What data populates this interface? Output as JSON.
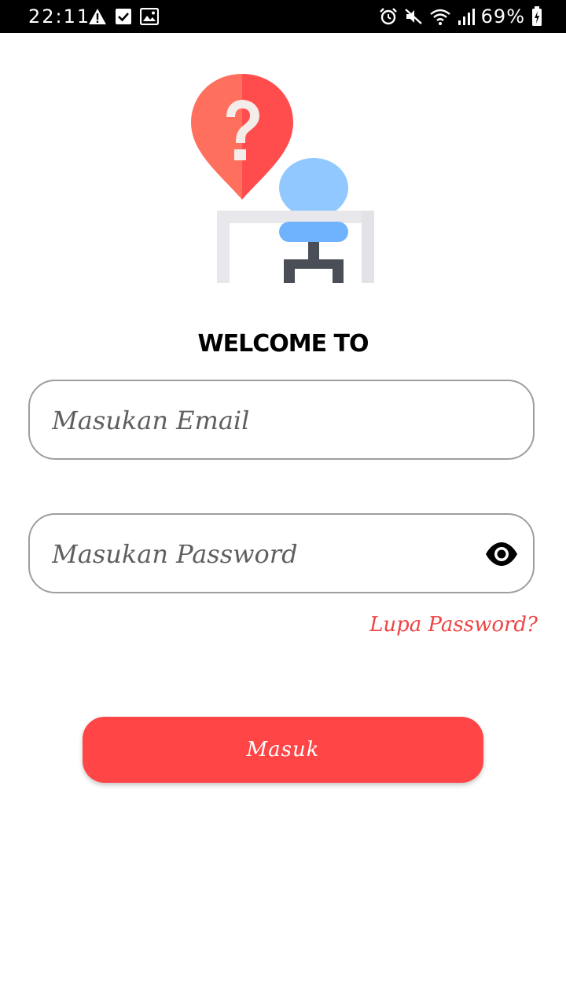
{
  "status_bar": {
    "time": "22:11",
    "battery_percent": "69%",
    "left_icons": [
      "warning-icon",
      "checkbox-icon",
      "image-icon"
    ],
    "right_icons": [
      "alarm-icon",
      "mute-icon",
      "wifi-icon",
      "signal-icon",
      "battery-charging-icon"
    ]
  },
  "illustration": {
    "icon": "question-location-desk-chair-illustration",
    "colors": {
      "pin_left": "#ff6f5e",
      "pin_right": "#ff4d4d",
      "chair": "#90c8ff",
      "chair_seat": "#6fb3ff",
      "chair_base": "#4a4f57",
      "desk": "#e8e8ec"
    }
  },
  "welcome": {
    "title": "WELCOME TO"
  },
  "form": {
    "email_placeholder": "Masukan Email",
    "email_value": "",
    "password_placeholder": "Masukan Password",
    "password_value": "",
    "password_toggle_icon": "eye-icon",
    "forgot_password": "Lupa Password?",
    "submit_label": "Masuk"
  },
  "colors": {
    "accent": "#ff4545",
    "link": "#ef4444",
    "field_border": "#9e9e9e"
  }
}
